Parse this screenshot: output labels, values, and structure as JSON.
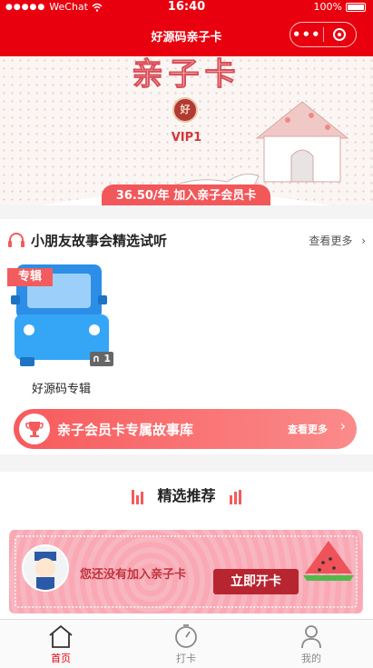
{
  "status_bar": {
    "carrier": "WeChat",
    "time": "16:40",
    "battery": "100%"
  },
  "nav": {
    "title": "好源码亲子卡",
    "more_icon": "more-dots-icon",
    "close_icon": "target-icon"
  },
  "banner": {
    "title": "亲子卡",
    "badge_text": "好",
    "level": "VIP1",
    "join_label": "36.50/年 加入亲子会员卡"
  },
  "story_section": {
    "title": "小朋友故事会精选试听",
    "more": "查看更多",
    "album": {
      "tag": "专辑",
      "count": "1",
      "name": "好源码专辑"
    },
    "library": {
      "title": "亲子会员卡专属故事库",
      "more": "查看更多"
    }
  },
  "recommend": {
    "title": "精选推荐",
    "card_text": "您还没有加入亲子卡",
    "open_label": "立即开卡"
  },
  "tabs": [
    {
      "label": "首页",
      "icon": "home-icon",
      "active": true
    },
    {
      "label": "打卡",
      "icon": "clock-icon",
      "active": false
    },
    {
      "label": "我的",
      "icon": "user-icon",
      "active": false
    }
  ],
  "colors": {
    "brand": "#e8000e",
    "accent": "#f25c5e",
    "button": "#b72531"
  }
}
